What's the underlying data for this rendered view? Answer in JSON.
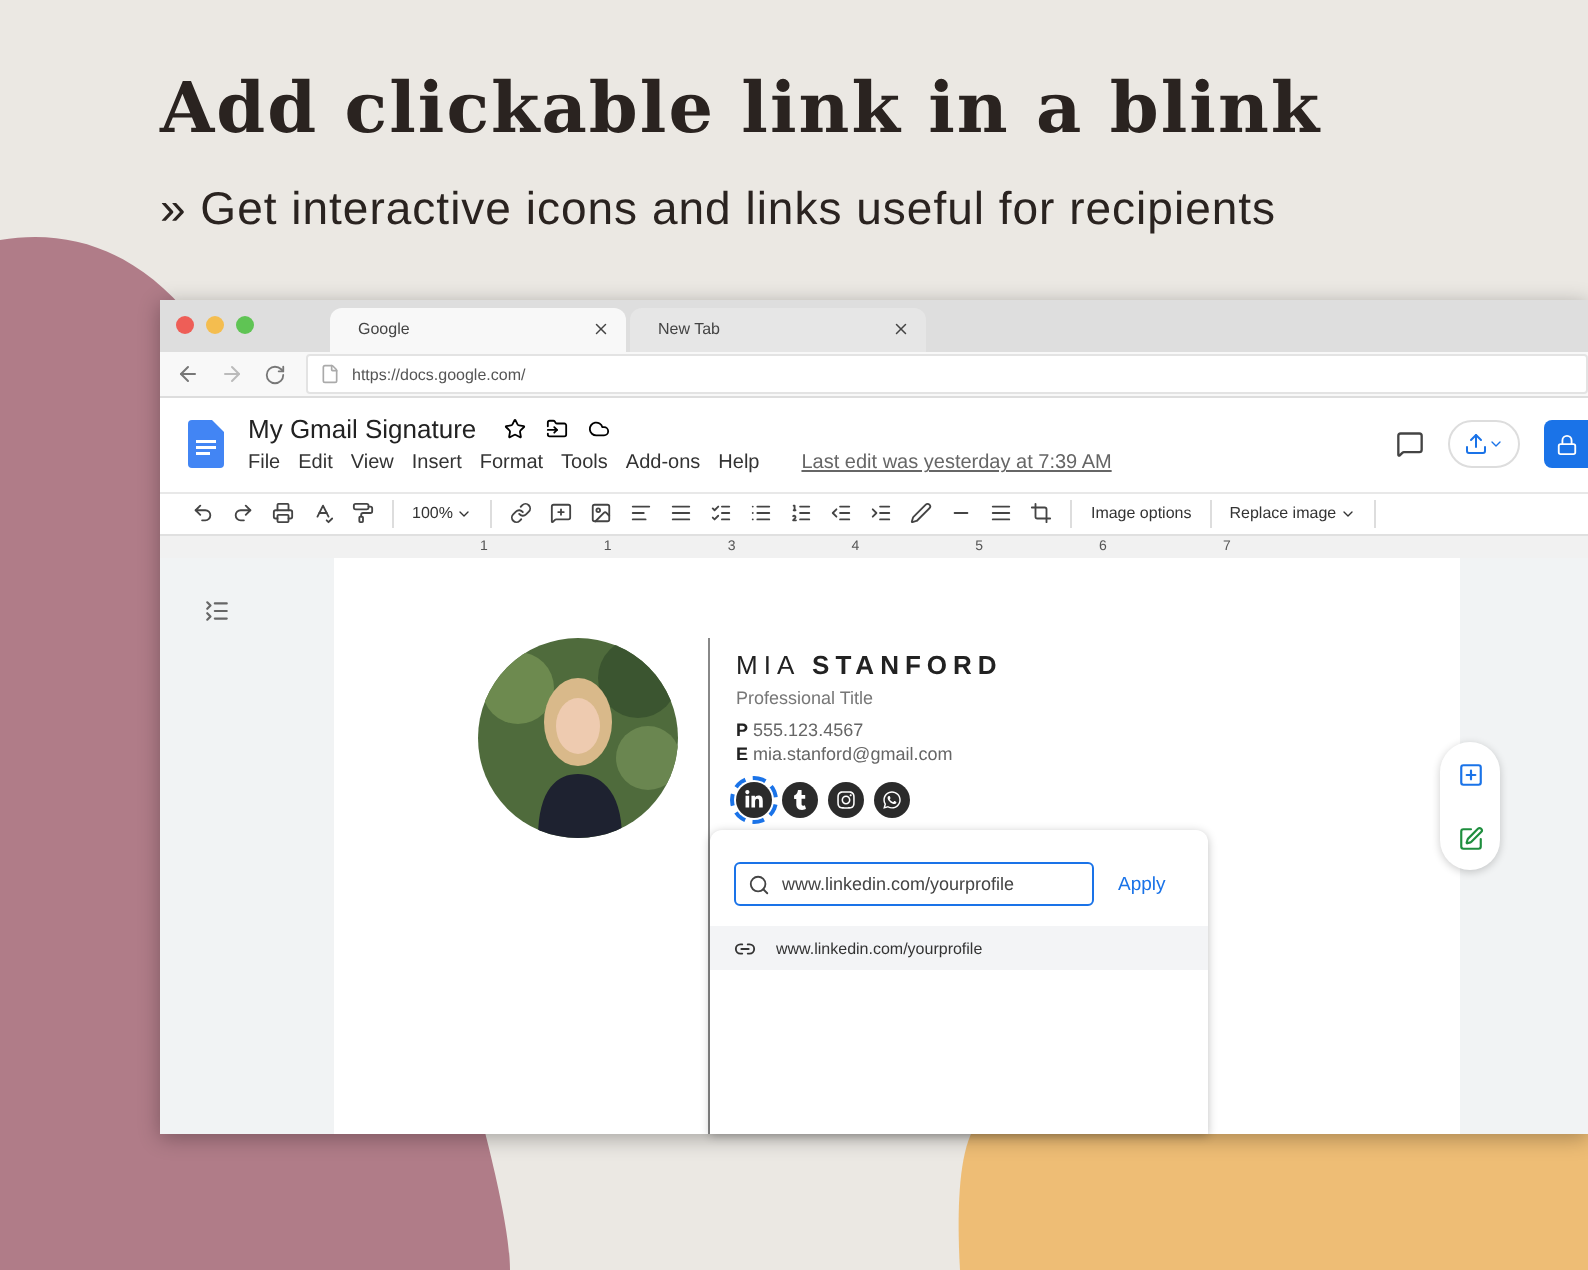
{
  "headline": "Add clickable link in a blink",
  "subtitle": "» Get interactive icons and links useful for recipients",
  "browser": {
    "tabs": [
      {
        "label": "Google",
        "selected": true
      },
      {
        "label": "New Tab",
        "selected": false
      }
    ],
    "address": "https://docs.google.com/"
  },
  "document": {
    "title": "My Gmail Signature",
    "menus": [
      "File",
      "Edit",
      "View",
      "Insert",
      "Format",
      "Tools",
      "Add-ons",
      "Help"
    ],
    "last_edit": "Last edit was yesterday at 7:39 AM"
  },
  "toolbar": {
    "zoom": "100%",
    "image_options": "Image options",
    "replace_image": "Replace image"
  },
  "ruler": [
    "1",
    "1",
    "3",
    "4",
    "5",
    "6",
    "7"
  ],
  "signature": {
    "first_name": "MIA",
    "last_name": "STANFORD",
    "job_title": "Professional Title",
    "contacts": [
      {
        "label": "P",
        "value": "555.123.4567"
      },
      {
        "label": "E",
        "value": "mia.stanford@gmail.com"
      }
    ],
    "social_icons": [
      {
        "kind": "linkedin",
        "selected": true
      },
      {
        "kind": "tumblr",
        "selected": false
      },
      {
        "kind": "instagram",
        "selected": false
      },
      {
        "kind": "whatsapp",
        "selected": false
      }
    ]
  },
  "link_popup": {
    "value": "www.linkedin.com/yourprofile",
    "apply": "Apply",
    "suggestion": "www.linkedin.com/yourprofile"
  }
}
